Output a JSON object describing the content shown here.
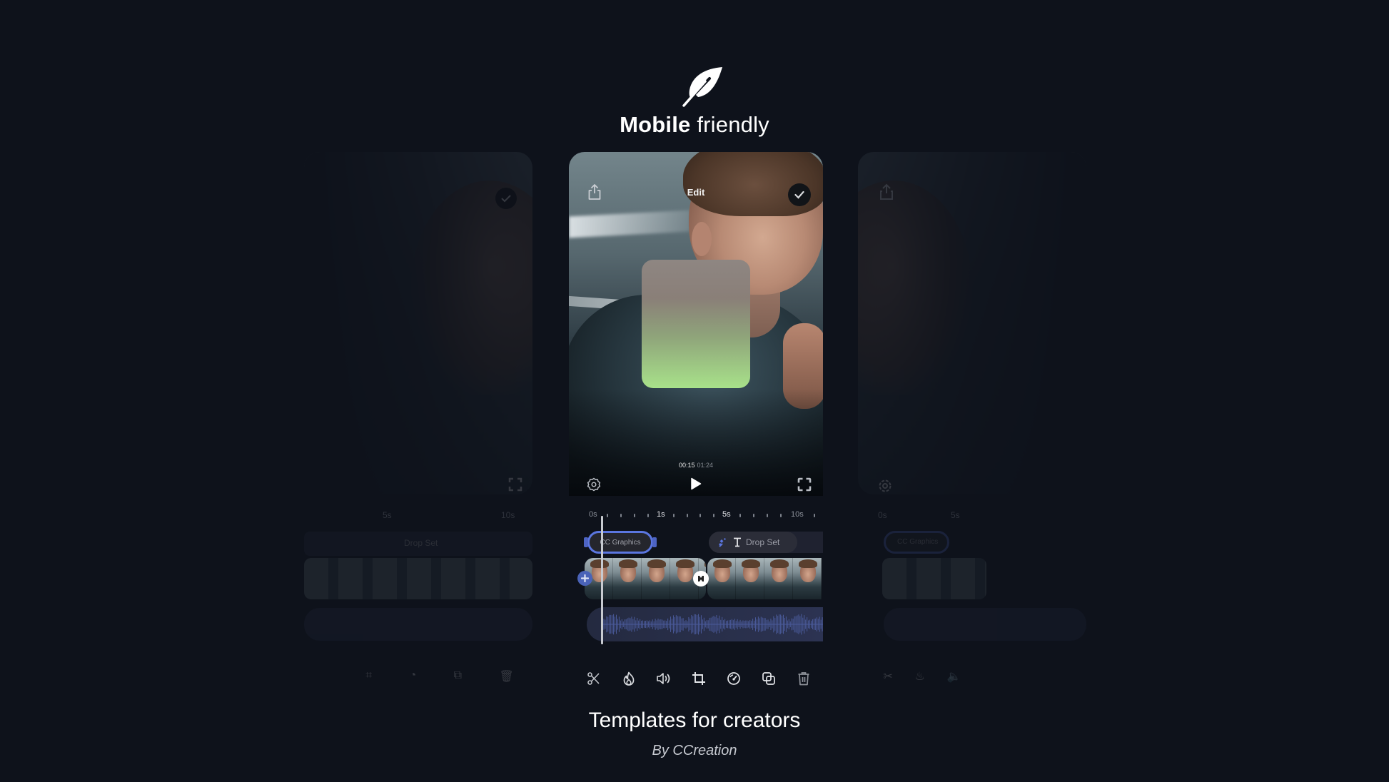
{
  "header": {
    "logo_icon": "feather-icon",
    "title_bold": "Mobile",
    "title_light": "friendly"
  },
  "editor": {
    "screen_title": "Edit",
    "share_icon": "share-icon",
    "done_icon": "checkmark-icon",
    "player": {
      "current_time": "00:15",
      "total_time": "01:24",
      "settings_icon": "gear-icon",
      "play_icon": "play-icon",
      "fullscreen_icon": "fullscreen-icon"
    },
    "overlay_gradient": {
      "top": "#8e8682",
      "bottom": "#a8e28a"
    },
    "timeline": {
      "ruler_labels": [
        {
          "text": "0s",
          "style": "dim"
        },
        {
          "text": "1s",
          "style": "bright"
        },
        {
          "text": "5s",
          "style": "bright"
        },
        {
          "text": "10s",
          "style": "dim"
        }
      ],
      "graphics_clip_label": "CC Graphics",
      "text_clip_label": "Drop Set",
      "text_clip_icons": [
        "sparkle-icon",
        "text-cursor-icon"
      ],
      "add_clip_icon": "plus-icon",
      "transition_icon": "transition-icon",
      "accent_color": "#5b76e0"
    },
    "toolbar": [
      {
        "name": "split",
        "icon": "scissors-icon"
      },
      {
        "name": "effects",
        "icon": "flame-icon"
      },
      {
        "name": "volume",
        "icon": "speaker-icon"
      },
      {
        "name": "crop",
        "icon": "crop-icon"
      },
      {
        "name": "speed",
        "icon": "speedometer-icon"
      },
      {
        "name": "duplicate",
        "icon": "duplicate-icon"
      },
      {
        "name": "delete",
        "icon": "trash-icon"
      }
    ]
  },
  "ghost_left": {
    "ruler_labels": [
      "5s",
      "10s"
    ],
    "text_clip_label": "Drop Set"
  },
  "ghost_right": {
    "ruler_labels": [
      "0s",
      "5s"
    ],
    "graphics_clip_label": "CC Graphics"
  },
  "footer": {
    "title": "Templates for creators",
    "subtitle": "By CCreation"
  },
  "colors": {
    "background": "#0e121b",
    "accent": "#5b76e0"
  }
}
